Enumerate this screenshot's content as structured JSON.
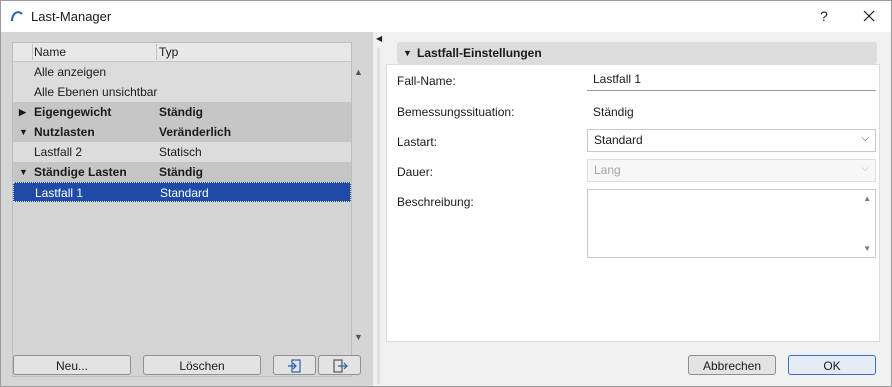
{
  "window": {
    "title": "Last-Manager",
    "help_label": "?"
  },
  "tree": {
    "columns": {
      "name": "Name",
      "typ": "Typ"
    },
    "rows": [
      {
        "name": "Alle anzeigen",
        "typ": ""
      },
      {
        "name": "Alle Ebenen unsichtbar",
        "typ": ""
      },
      {
        "name": "Eigengewicht",
        "typ": "Ständig"
      },
      {
        "name": "Nutzlasten",
        "typ": "Veränderlich"
      },
      {
        "name": "Lastfall 2",
        "typ": "Statisch"
      },
      {
        "name": "Ständige Lasten",
        "typ": "Ständig"
      },
      {
        "name": "Lastfall 1",
        "typ": "Standard"
      }
    ]
  },
  "left_buttons": {
    "new": "Neu...",
    "delete": "Löschen"
  },
  "section": {
    "title": "Lastfall-Einstellungen"
  },
  "form": {
    "fall_name_label": "Fall-Name:",
    "fall_name_value": "Lastfall 1",
    "bemessung_label": "Bemessungssituation:",
    "bemessung_value": "Ständig",
    "lastart_label": "Lastart:",
    "lastart_value": "Standard",
    "dauer_label": "Dauer:",
    "dauer_value": "Lang",
    "beschreibung_label": "Beschreibung:",
    "beschreibung_value": ""
  },
  "dialog_buttons": {
    "cancel": "Abbrechen",
    "ok": "OK"
  },
  "icons": {
    "app": "arc-icon",
    "help": "question-icon",
    "close": "close-icon",
    "import": "import-icon",
    "export": "export-icon"
  },
  "colors": {
    "selection": "#1f4aa6",
    "ok_border": "#3b6fc7"
  }
}
